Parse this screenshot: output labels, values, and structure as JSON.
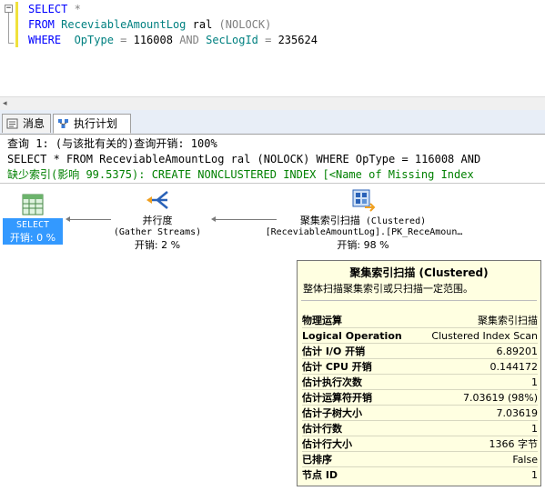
{
  "editor": {
    "collapse_glyph": "−",
    "line1": {
      "kw": "SELECT",
      "rest": " *"
    },
    "line2": {
      "kw": "FROM",
      "table": "ReceviableAmountLog",
      "alias": " ral ",
      "hint": "(NOLOCK)"
    },
    "line3": {
      "kw": "WHERE",
      "col1": "  OpType",
      "op1": " = ",
      "val1": "116008",
      "and": " AND ",
      "col2": "SecLogId",
      "op2": " = ",
      "val2": "235624"
    }
  },
  "scrollbar": {
    "left_arrow": "◂"
  },
  "tabs": [
    {
      "label": "消息",
      "icon": "messages-icon",
      "active": false
    },
    {
      "label": "执行计划",
      "icon": "execution-plan-icon",
      "active": true
    }
  ],
  "results": {
    "line1": "查询 1: (与该批有关的)查询开销: 100%",
    "line2": "SELECT * FROM ReceviableAmountLog ral (NOLOCK) WHERE OpType = 116008 AND",
    "line3": "缺少索引(影响 99.5375): CREATE NONCLUSTERED INDEX [<Name of Missing Index"
  },
  "plan": {
    "select": {
      "label": "SELECT",
      "cost": "开销: 0 %"
    },
    "parallel": {
      "label": "并行度",
      "sub": "(Gather Streams)",
      "cost": "开销: 2 %"
    },
    "scan": {
      "label": "聚集索引扫描",
      "label_suffix": " (Clustered)",
      "sub": "[ReceviableAmountLog].[PK_ReceAmoun…",
      "cost": "开销: 98 %"
    }
  },
  "tooltip": {
    "title": "聚集索引扫描 (Clustered)",
    "description": "整体扫描聚集索引或只扫描一定范围。",
    "rows": [
      {
        "key": "物理运算",
        "value": "聚集索引扫描"
      },
      {
        "key": "Logical Operation",
        "value": "Clustered Index Scan"
      },
      {
        "key": "估计 I/O 开销",
        "value": "6.89201"
      },
      {
        "key": "估计 CPU 开销",
        "value": "0.144172"
      },
      {
        "key": "估计执行次数",
        "value": "1"
      },
      {
        "key": "估计运算符开销",
        "value": "7.03619 (98%)"
      },
      {
        "key": "估计子树大小",
        "value": "7.03619"
      },
      {
        "key": "估计行数",
        "value": "1"
      },
      {
        "key": "估计行大小",
        "value": "1366 字节"
      },
      {
        "key": "已排序",
        "value": "False"
      },
      {
        "key": "节点 ID",
        "value": "1"
      }
    ]
  },
  "colors": {
    "keyword": "#0000ff",
    "table": "#008080",
    "operator": "#808080",
    "missing_index": "#008000",
    "selected_node": "#3399ff",
    "tooltip_bg": "#ffffe1"
  }
}
